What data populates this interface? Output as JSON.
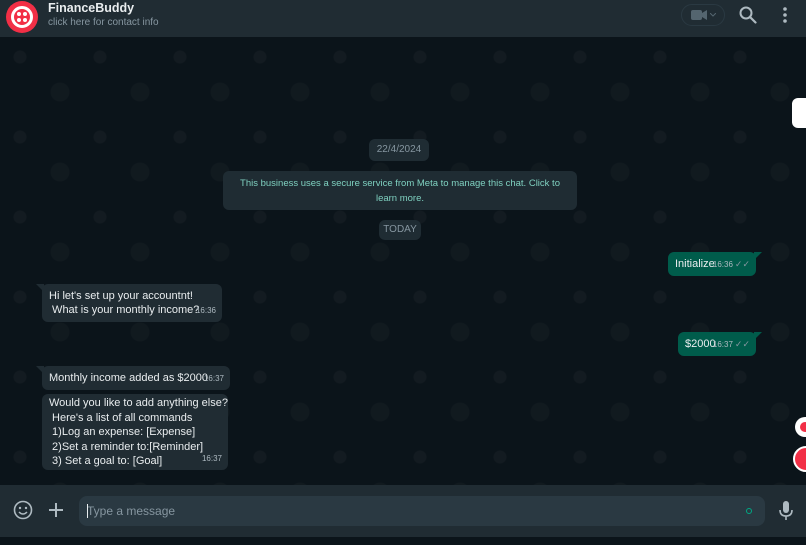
{
  "header": {
    "contact_name": "FinanceBuddy",
    "contact_subtitle": "click here for contact info",
    "icons": [
      "video-camera-icon",
      "search-icon",
      "kebab-menu-icon"
    ]
  },
  "chat": {
    "date_label": "22/4/2024",
    "encryption_notice": "This business uses a secure service from Meta to manage this chat. Click to learn more.",
    "today_label": "TODAY",
    "messages": [
      {
        "direction": "out",
        "text": "Initialize",
        "time": "16:36",
        "status": "read"
      },
      {
        "direction": "in",
        "line1": "Hi let's set up your accountnt!",
        "line2": " What is your monthly income?",
        "time": "16:36"
      },
      {
        "direction": "out",
        "text": "$2000",
        "time": "16:37",
        "status": "read"
      },
      {
        "direction": "in",
        "text": "Monthly income added as $2000",
        "time": "16:37"
      },
      {
        "direction": "in",
        "lines": [
          "Would you like to add anything else?",
          " Here's a list of all commands",
          " 1)Log an expense: [Expense]",
          " 2)Set a reminder to:[Reminder]",
          " 3) Set a goal to: [Goal]"
        ],
        "time": "16:37"
      }
    ]
  },
  "composer": {
    "placeholder": "Type a message",
    "icons": [
      "emoji-icon",
      "plus-icon",
      "microphone-icon"
    ]
  },
  "colors": {
    "header_bg": "#202c33",
    "chat_bg": "#0b141a",
    "incoming_bubble": "#202c33",
    "outgoing_bubble": "#005c4b",
    "brand_red": "#f22f46"
  }
}
